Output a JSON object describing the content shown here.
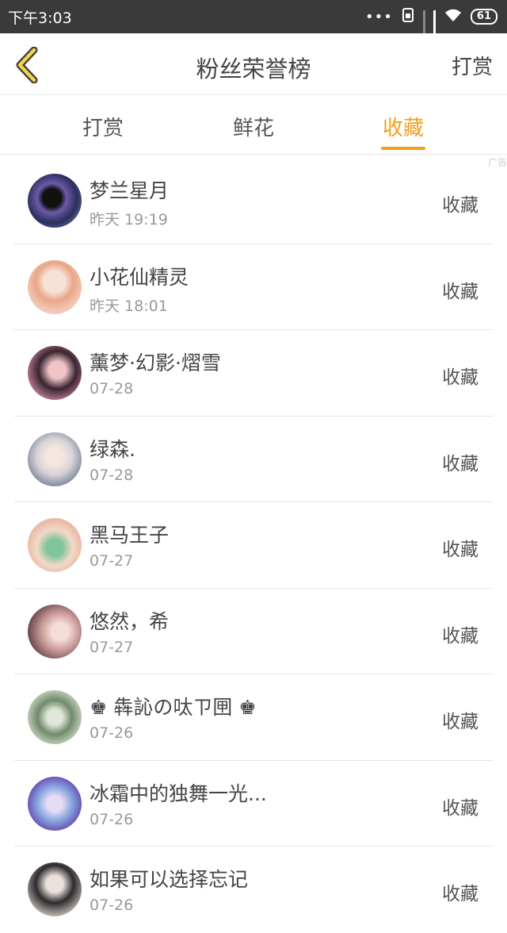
{
  "status_bar": {
    "time": "下午3:03",
    "dots": "•••",
    "battery": "61"
  },
  "nav": {
    "title": "粉丝荣誉榜",
    "action": "打赏"
  },
  "tabs": [
    {
      "label": "打赏"
    },
    {
      "label": "鲜花"
    },
    {
      "label": "收藏"
    }
  ],
  "active_tab": "收藏",
  "ad_label": "广告",
  "colors": {
    "accent": "#f0a01e",
    "status_bar_bg": "#3a3a3a",
    "divider": "#e4e4e4"
  },
  "fans": [
    {
      "name": "梦兰星月",
      "time": "昨天 19:19",
      "action": "收藏"
    },
    {
      "name": "小花仙精灵",
      "time": "昨天 18:01",
      "action": "收藏"
    },
    {
      "name": "薰梦·幻影·熠雪",
      "time": "07-28",
      "action": "收藏"
    },
    {
      "name": "绿森.",
      "time": "07-28",
      "action": "收藏"
    },
    {
      "name": "黑马王子",
      "time": "07-27",
      "action": "收藏"
    },
    {
      "name": "悠然，希",
      "time": "07-27",
      "action": "收藏"
    },
    {
      "name": "♚ 犇訫の呔ㄗ㘡 ♚",
      "time": "07-26",
      "action": "收藏"
    },
    {
      "name": "冰霜中的独舞一光...",
      "time": "07-26",
      "action": "收藏"
    },
    {
      "name": "如果可以选择忘记",
      "time": "07-26",
      "action": "收藏"
    }
  ]
}
